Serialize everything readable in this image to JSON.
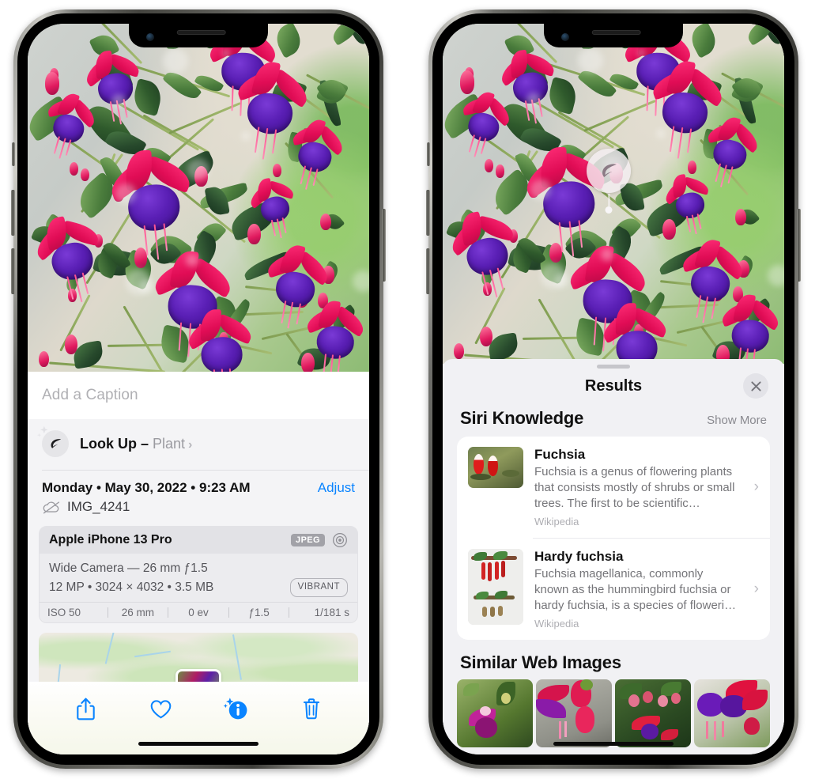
{
  "left_phone": {
    "caption": {
      "placeholder": "Add a Caption",
      "value": ""
    },
    "lookup": {
      "label": "Look Up – ",
      "subject": "Plant",
      "chevron": "›",
      "icon": "leaf-icon"
    },
    "info": {
      "date": "Monday • May 30, 2022 • 9:23 AM",
      "adjust": "Adjust",
      "filename": "IMG_4241",
      "cloud_icon": "cloud-slash-icon"
    },
    "exif": {
      "model": "Apple iPhone 13 Pro",
      "format_badge": "JPEG",
      "aperture_icon": "aperture-icon",
      "lens": "Wide Camera — 26 mm ƒ1.5",
      "specs": "12 MP • 3024 × 4032 • 3.5 MB",
      "style_badge": "VIBRANT",
      "stats": [
        "ISO 50",
        "26 mm",
        "0 ev",
        "ƒ1.5",
        "1/181 s"
      ]
    },
    "toolbar": [
      {
        "name": "share-icon",
        "label": "Share"
      },
      {
        "name": "heart-icon",
        "label": "Favorite"
      },
      {
        "name": "info-sparkle-icon",
        "label": "Info"
      },
      {
        "name": "trash-icon",
        "label": "Delete"
      }
    ]
  },
  "right_phone": {
    "badge": {
      "icon": "leaf-icon"
    },
    "sheet": {
      "title": "Results",
      "close_icon": "close-icon",
      "siri_knowledge": {
        "title": "Siri Knowledge",
        "show_more": "Show More",
        "items": [
          {
            "title": "Fuchsia",
            "description": "Fuchsia is a genus of flowering plants that consists mostly of shrubs or small trees. The first to be scientific…",
            "source": "Wikipedia",
            "chevron": "›"
          },
          {
            "title": "Hardy fuchsia",
            "description": "Fuchsia magellanica, commonly known as the hummingbird fuchsia or hardy fuchsia, is a species of floweri…",
            "source": "Wikipedia",
            "chevron": "›"
          }
        ]
      },
      "similar_web_images": {
        "title": "Similar Web Images",
        "count": 4
      }
    }
  },
  "colors": {
    "accent_blue": "#0a84ff",
    "sheet_bg": "#f1f1f4",
    "card_bg": "#ffffff",
    "secondary_text": "#8a8a90",
    "badge_gray": "#a2a2a8"
  }
}
